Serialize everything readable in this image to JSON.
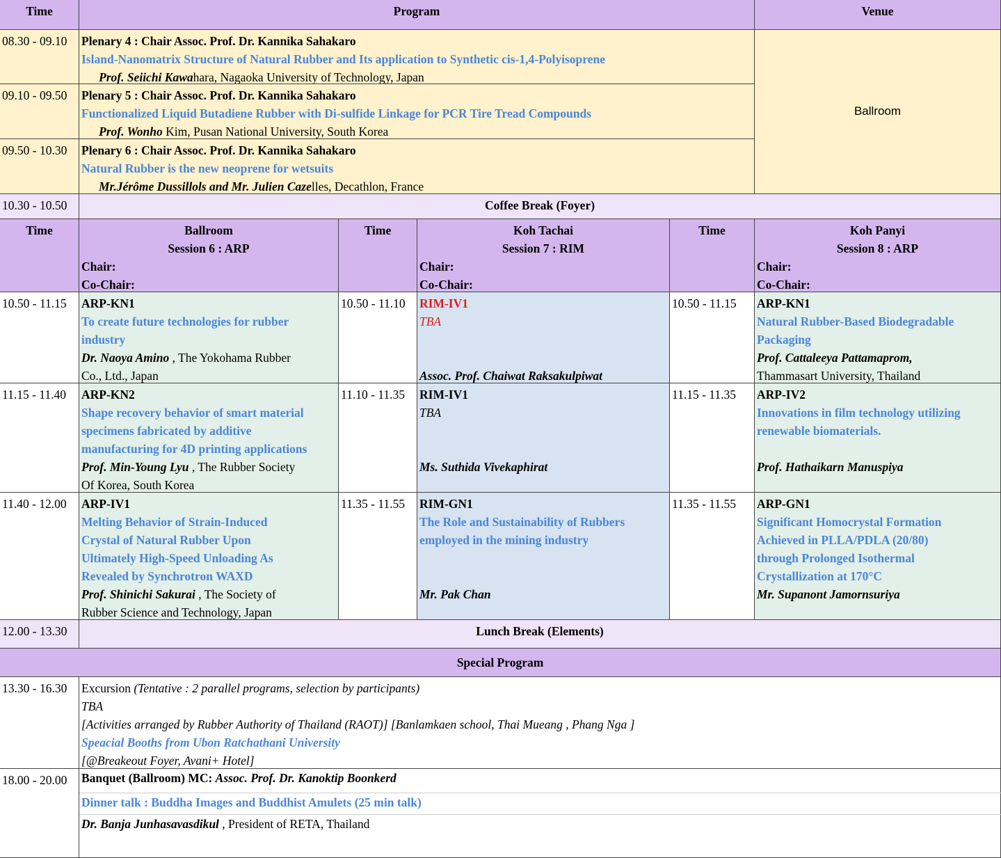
{
  "header": {
    "time": "Time",
    "program": "Program",
    "venue": "Venue"
  },
  "plenaries": [
    {
      "time": "08.30 - 09.10",
      "chair": "Plenary 4 : Chair  Assoc. Prof. Dr. Kannika Sahakaro",
      "title": "Island-Nanomatrix Structure of Natural Rubber and Its application to Synthetic cis-1,4-Polyisoprene",
      "speaker": "Prof. Seiichi Kawa",
      "affiliation": "hara, Nagaoka University of Technology, Japan"
    },
    {
      "time": "09.10 - 09.50",
      "chair": "Plenary 5 : Chair  Assoc. Prof. Dr. Kannika Sahakaro",
      "title": "Functionalized Liquid Butadiene Rubber with Di-sulfide Linkage for PCR Tire Tread Compounds",
      "speaker": "Prof. Wonho",
      "affiliation": " Kim, Pusan National University, South Korea"
    },
    {
      "time": "09.50 - 10.30",
      "chair": "Plenary 6 : Chair  Assoc. Prof. Dr. Kannika Sahakaro",
      "title": "Natural Rubber is the new neoprene for wetsuits",
      "speaker": "Mr.Jérôme Dussillols and Mr. Julien Caze",
      "affiliation": "lles, Decathlon, France"
    }
  ],
  "plenary_venue": "Ballroom",
  "coffee": {
    "time": "10.30 - 10.50",
    "label": "Coffee Break (Foyer)"
  },
  "sessions_header": {
    "time": "Time",
    "rooms": [
      {
        "name": "Ballroom",
        "session": "Session 6 : ARP",
        "chair": "Chair:",
        "cochair": "Co-Chair:"
      },
      {
        "name": "Koh Tachai",
        "session": "Session 7 : RIM",
        "chair": "Chair:",
        "cochair": "Co-Chair:"
      },
      {
        "name": "Koh Panyi",
        "session": "Session 8 : ARP",
        "chair": "Chair:",
        "cochair": "Co-Chair:"
      }
    ]
  },
  "slots": [
    {
      "ballroom": {
        "time": "10.50 - 11.15",
        "code": "ARP-KN1",
        "title": [
          "To create future technologies for rubber",
          "industry"
        ],
        "speaker": "Dr. Naoya Amino",
        "aff1": " , The Yokohama Rubber",
        "aff2": "Co., Ltd., Japan"
      },
      "tachai": {
        "time": "10.50 - 11.10",
        "code": "RIM-IV1",
        "title": "TBA",
        "speaker": "Assoc. Prof. Chaiwat Raksakulpiwat"
      },
      "panyi": {
        "time": "10.50 - 11.15",
        "code": "ARP-KN1",
        "title": [
          "Natural Rubber-Based Biodegradable",
          "Packaging"
        ],
        "speaker": "Prof. Cattaleeya Pattamaprom,",
        "aff": "Thammasart University, Thailand"
      }
    },
    {
      "ballroom": {
        "time": "11.15 - 11.40",
        "code": "ARP-KN2",
        "title": [
          "Shape recovery behavior of smart material",
          "specimens fabricated by additive",
          "manufacturing for 4D printing applications"
        ],
        "speaker": "Prof. Min-Young Lyu",
        "aff1": " , The Rubber Society",
        "aff2": "Of Korea, South Korea"
      },
      "tachai": {
        "time": "11.10 - 11.35",
        "code": "RIM-IV1",
        "title": "TBA",
        "speaker": "Ms. Suthida Vivekaphirat"
      },
      "panyi": {
        "time": "11.15 - 11.35",
        "code": "ARP-IV2",
        "title": [
          "Innovations in film technology utilizing",
          "renewable biomaterials."
        ],
        "speaker": "Prof. Hathaikarn Manuspiya"
      }
    },
    {
      "ballroom": {
        "time": "11.40 - 12.00",
        "code": "ARP-IV1",
        "title": [
          "Melting Behavior of Strain-Induced",
          "Crystal of Natural Rubber Upon",
          "Ultimately High-Speed Unloading As",
          "Revealed by Synchrotron WAXD"
        ],
        "speaker": "Prof. Shinichi Sakurai",
        "aff1": " , The Society of",
        "aff2": "Rubber Science and Technology, Japan"
      },
      "tachai": {
        "time": "11.35 - 11.55",
        "code": "RIM-GN1",
        "title": [
          "The Role and Sustainability of Rubbers",
          "employed in the mining industry"
        ],
        "speaker": "Mr. Pak Chan"
      },
      "panyi": {
        "time": "11.35 - 11.55",
        "code": "ARP-GN1",
        "title": [
          "Significant Homocrystal Formation",
          "Achieved in PLLA/PDLA (20/80)",
          "through Prolonged Isothermal",
          "Crystallization at 170°C"
        ],
        "speaker": "Mr. Supanont Jamornsuriya"
      }
    }
  ],
  "lunch": {
    "time": "12.00 - 13.30",
    "label": "Lunch Break (Elements)"
  },
  "special": "Special Program",
  "excursion": {
    "time": "13.30 - 16.30",
    "label": "Excursion ",
    "note": "(Tentative : 2 parallel programs, selection by participants)",
    "tba": "TBA",
    "activities": "[Activities arranged by Rubber Authority of Thailand (RAOT)]  [Banlamkaen school, Thai Mueang , Phang Nga  ]",
    "booths": "Speacial Booths from Ubon Ratchathani University",
    "location": "[@Breakeout Foyer, Avani+ Hotel]"
  },
  "banquet": {
    "time": "18.00 - 20.00",
    "label": "Banquet (Ballroom) MC: ",
    "mc": "Assoc. Prof. Dr. Kanoktip Boonkerd",
    "talk": "Dinner talk : Buddha Images and Buddhist Amulets (25 min talk)",
    "speaker": "Dr. Banja Junhasavasdikul",
    "aff": "  , President of RETA, Thailand"
  },
  "colors": {
    "header": "#d4b6ee",
    "plenary": "#fff2cc",
    "break": "#f0e4f8",
    "session_green": "#e3f0e9",
    "session_blue": "#d7e3f1",
    "title_blue": "#4a86d8",
    "red": "#e01b1b"
  }
}
